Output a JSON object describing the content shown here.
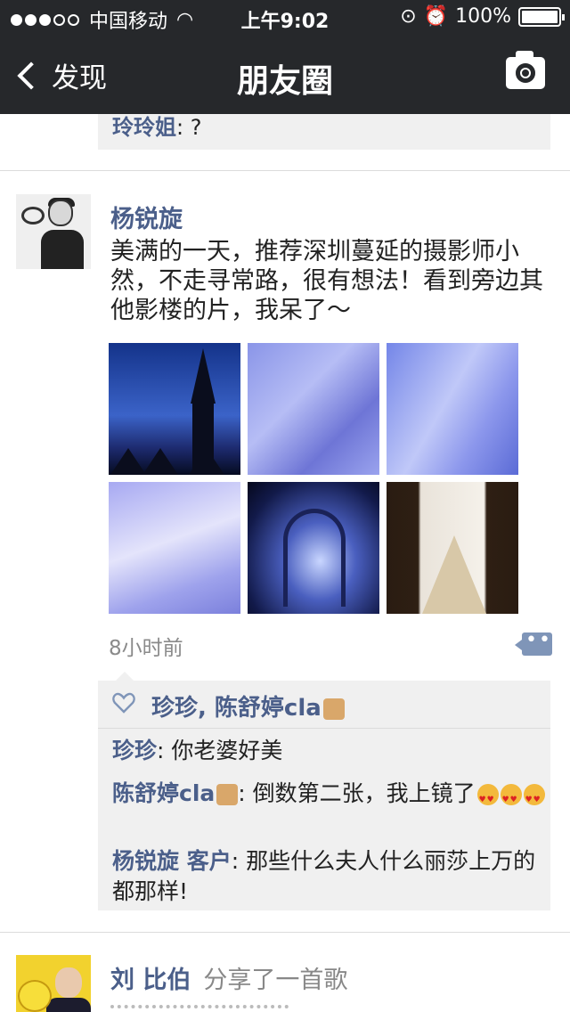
{
  "status_bar": {
    "carrier": "中国移动",
    "time": "上午9:02",
    "battery": "100%",
    "battery_level": 1.0,
    "signal_bars_filled": 3,
    "signal_bars_total": 5
  },
  "nav": {
    "back_label": "发现",
    "title": "朋友圈"
  },
  "previous_post": {
    "comment_author": "玲玲姐",
    "comment_text": ": ?"
  },
  "post": {
    "author": "杨锐旋",
    "text": "美满的一天，推荐深圳蔓延的摄影师小然，不走寻常路，很有想法！看到旁边其他影楼的片，我呆了～",
    "time": "8小时前",
    "photos": [
      "church-at-dusk",
      "bride-portrait",
      "couple-portrait",
      "bride-dress",
      "couple-arch",
      "bride-window"
    ],
    "likes": "珍珍, 陈舒婷cla",
    "comments": [
      {
        "author": "珍珍",
        "text": ": 你老婆好美"
      },
      {
        "author": "陈舒婷cla",
        "text": ": 倒数第二张，我上镜了"
      },
      {
        "author": "杨锐旋 客户",
        "text": ": 那些什么夫人什么丽莎上万的都那样!"
      }
    ]
  },
  "next_post": {
    "author": "刘 比伯",
    "action": "分享了一首歌"
  },
  "colors": {
    "nav_bg": "#26282b",
    "name_blue": "#4b5f8a",
    "comment_bg": "#f0f0f0"
  },
  "icons": {
    "back": "chevron-left-icon",
    "camera": "camera-icon",
    "like": "heart-icon",
    "comment": "comment-icon"
  }
}
